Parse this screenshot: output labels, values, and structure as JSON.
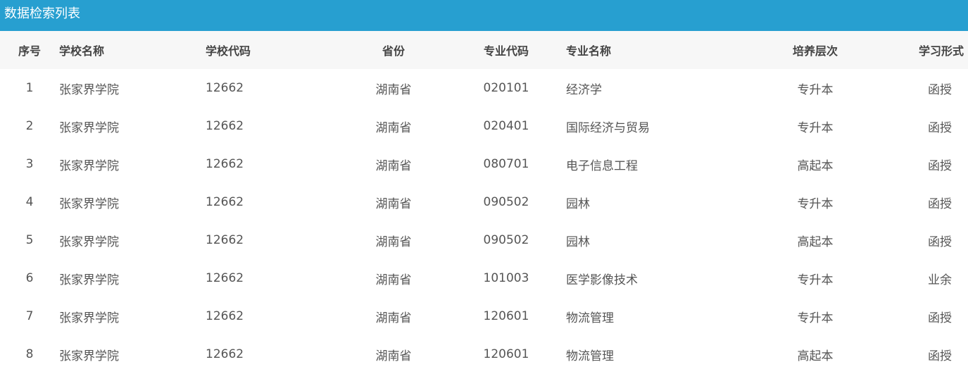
{
  "panel": {
    "title": "数据检索列表"
  },
  "table": {
    "headers": {
      "index": "序号",
      "school_name": "学校名称",
      "school_code": "学校代码",
      "province": "省份",
      "major_code": "专业代码",
      "major_name": "专业名称",
      "level": "培养层次",
      "study_form": "学习形式"
    },
    "rows": [
      {
        "index": "1",
        "school_name": "张家界学院",
        "school_code": "12662",
        "province": "湖南省",
        "major_code": "020101",
        "major_name": "经济学",
        "level": "专升本",
        "study_form": "函授"
      },
      {
        "index": "2",
        "school_name": "张家界学院",
        "school_code": "12662",
        "province": "湖南省",
        "major_code": "020401",
        "major_name": "国际经济与贸易",
        "level": "专升本",
        "study_form": "函授"
      },
      {
        "index": "3",
        "school_name": "张家界学院",
        "school_code": "12662",
        "province": "湖南省",
        "major_code": "080701",
        "major_name": "电子信息工程",
        "level": "高起本",
        "study_form": "函授"
      },
      {
        "index": "4",
        "school_name": "张家界学院",
        "school_code": "12662",
        "province": "湖南省",
        "major_code": "090502",
        "major_name": "园林",
        "level": "专升本",
        "study_form": "函授"
      },
      {
        "index": "5",
        "school_name": "张家界学院",
        "school_code": "12662",
        "province": "湖南省",
        "major_code": "090502",
        "major_name": "园林",
        "level": "高起本",
        "study_form": "函授"
      },
      {
        "index": "6",
        "school_name": "张家界学院",
        "school_code": "12662",
        "province": "湖南省",
        "major_code": "101003",
        "major_name": "医学影像技术",
        "level": "专升本",
        "study_form": "业余"
      },
      {
        "index": "7",
        "school_name": "张家界学院",
        "school_code": "12662",
        "province": "湖南省",
        "major_code": "120601",
        "major_name": "物流管理",
        "level": "专升本",
        "study_form": "函授"
      },
      {
        "index": "8",
        "school_name": "张家界学院",
        "school_code": "12662",
        "province": "湖南省",
        "major_code": "120601",
        "major_name": "物流管理",
        "level": "高起本",
        "study_form": "函授"
      }
    ]
  },
  "colors": {
    "title_bar": "#279fd0",
    "header_bg": "#f7f7f7"
  }
}
